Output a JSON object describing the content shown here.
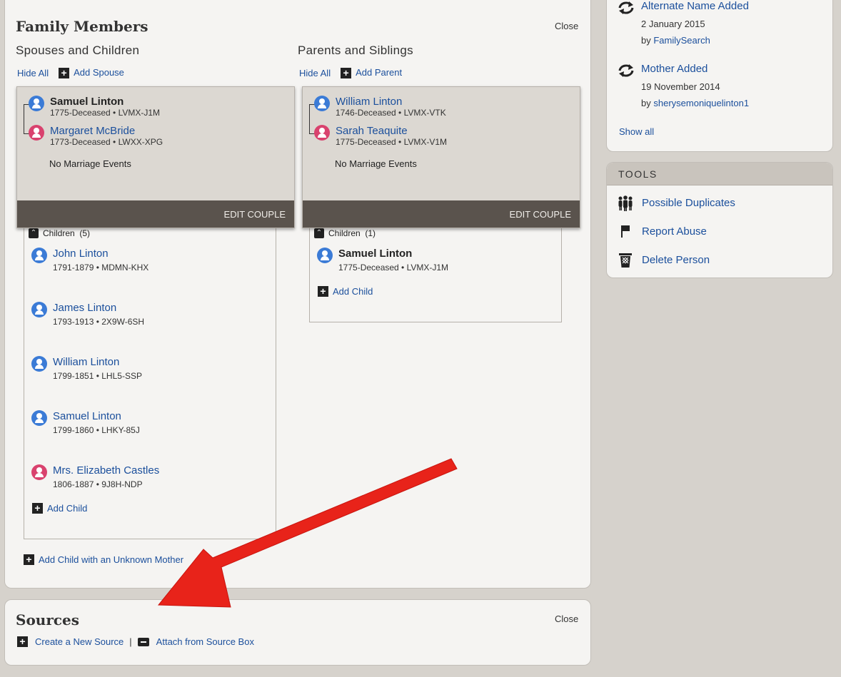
{
  "family": {
    "title": "Family Members",
    "close": "Close",
    "spouses": {
      "title": "Spouses and Children",
      "hide_all": "Hide All",
      "add_spouse": "Add Spouse",
      "couple": {
        "husband": {
          "name": "Samuel Linton",
          "meta": "1775-Deceased • LVMX-J1M"
        },
        "wife": {
          "name": "Margaret McBride",
          "meta": "1773-Deceased • LWXX-XPG"
        },
        "no_marriage": "No Marriage Events",
        "edit": "EDIT COUPLE"
      },
      "children_label": "Children",
      "children_count": "(5)",
      "children": [
        {
          "name": "John Linton",
          "meta": "1791-1879 • MDMN-KHX",
          "sex": "male"
        },
        {
          "name": "James Linton",
          "meta": "1793-1913 • 2X9W-6SH",
          "sex": "male"
        },
        {
          "name": "William Linton",
          "meta": "1799-1851 • LHL5-SSP",
          "sex": "male"
        },
        {
          "name": "Samuel Linton",
          "meta": "1799-1860 • LHKY-85J",
          "sex": "male"
        },
        {
          "name": "Mrs. Elizabeth Castles",
          "meta": "1806-1887 • 9J8H-NDP",
          "sex": "female"
        }
      ],
      "add_child": "Add Child",
      "add_child_unknown": "Add Child with an Unknown Mother"
    },
    "parents": {
      "title": "Parents and Siblings",
      "hide_all": "Hide All",
      "add_parent": "Add Parent",
      "couple": {
        "father": {
          "name": "William Linton",
          "meta": "1746-Deceased • LVMX-VTK"
        },
        "mother": {
          "name": "Sarah Teaquite",
          "meta": "1775-Deceased • LVMX-V1M"
        },
        "no_marriage": "No Marriage Events",
        "edit": "EDIT COUPLE"
      },
      "children_label": "Children",
      "children_count": "(1)",
      "children": [
        {
          "name": "Samuel Linton",
          "meta": "1775-Deceased • LVMX-J1M",
          "sex": "male"
        }
      ],
      "add_child": "Add Child"
    }
  },
  "sources": {
    "title": "Sources",
    "close": "Close",
    "create": "Create a New Source",
    "separator": "|",
    "attach": "Attach from Source Box"
  },
  "changes": {
    "items": [
      {
        "title": "Alternate Name Added",
        "date": "2 January 2015",
        "by_prefix": "by",
        "by": "FamilySearch"
      },
      {
        "title": "Mother Added",
        "date": "19 November 2014",
        "by_prefix": "by",
        "by": "sherysemoniquelinton1"
      }
    ],
    "show_all": "Show all"
  },
  "tools": {
    "title": "TOOLS",
    "items": [
      {
        "label": "Possible Duplicates",
        "icon": "people-icon"
      },
      {
        "label": "Report Abuse",
        "icon": "flag-icon"
      },
      {
        "label": "Delete Person",
        "icon": "trash-icon"
      }
    ]
  },
  "colors": {
    "link": "#1b4f9c",
    "male": "#3b7bd6",
    "female": "#d9426e",
    "arrow": "#e8231a"
  }
}
